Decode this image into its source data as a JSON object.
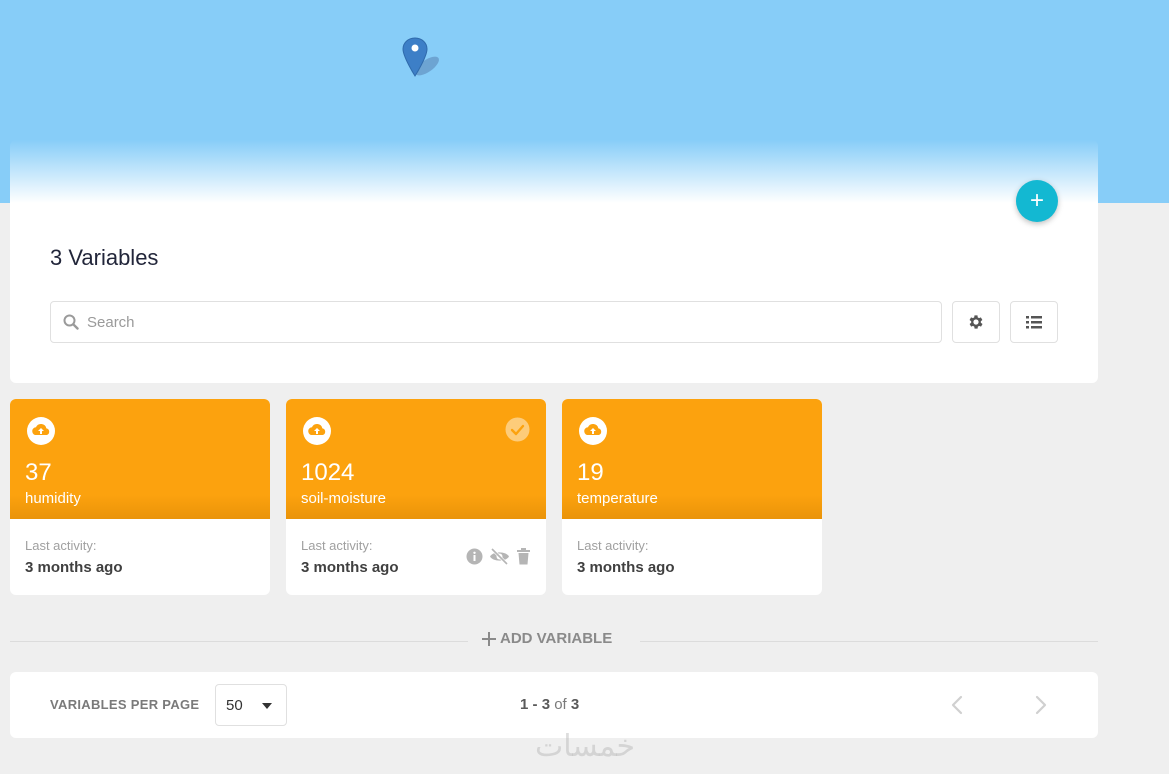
{
  "header": {
    "add_button_label": "+"
  },
  "main": {
    "title": "3 Variables",
    "search": {
      "placeholder": "Search",
      "value": ""
    },
    "settings_icon": "gear-icon",
    "list_view_icon": "list-icon"
  },
  "cards": [
    {
      "value": "37",
      "label": "humidity",
      "icon": "cloud-upload-icon",
      "activity_label": "Last activity:",
      "activity_value": "3 months ago"
    },
    {
      "value": "1024",
      "label": "soil-moisture",
      "icon": "cloud-upload-icon",
      "selected": true,
      "activity_label": "Last activity:",
      "activity_value": "3 months ago",
      "actions": [
        "info-icon",
        "eye-slash-icon",
        "trash-icon"
      ]
    },
    {
      "value": "19",
      "label": "temperature",
      "icon": "cloud-upload-icon",
      "activity_label": "Last activity:",
      "activity_value": "3 months ago"
    }
  ],
  "add_variable": {
    "label": "ADD VARIABLE"
  },
  "pagination": {
    "per_page_label": "VARIABLES PER PAGE",
    "per_page_value": "50",
    "range_start": "1",
    "range_sep": " - ",
    "range_end": "3",
    "of_label": " of ",
    "total": "3"
  },
  "watermark": {
    "text": "خمسات"
  },
  "colors": {
    "header_bg": "#87cdf8",
    "accent_fab": "#13b8d2",
    "card_orange": "#fca20e",
    "page_bg": "#efefef"
  }
}
